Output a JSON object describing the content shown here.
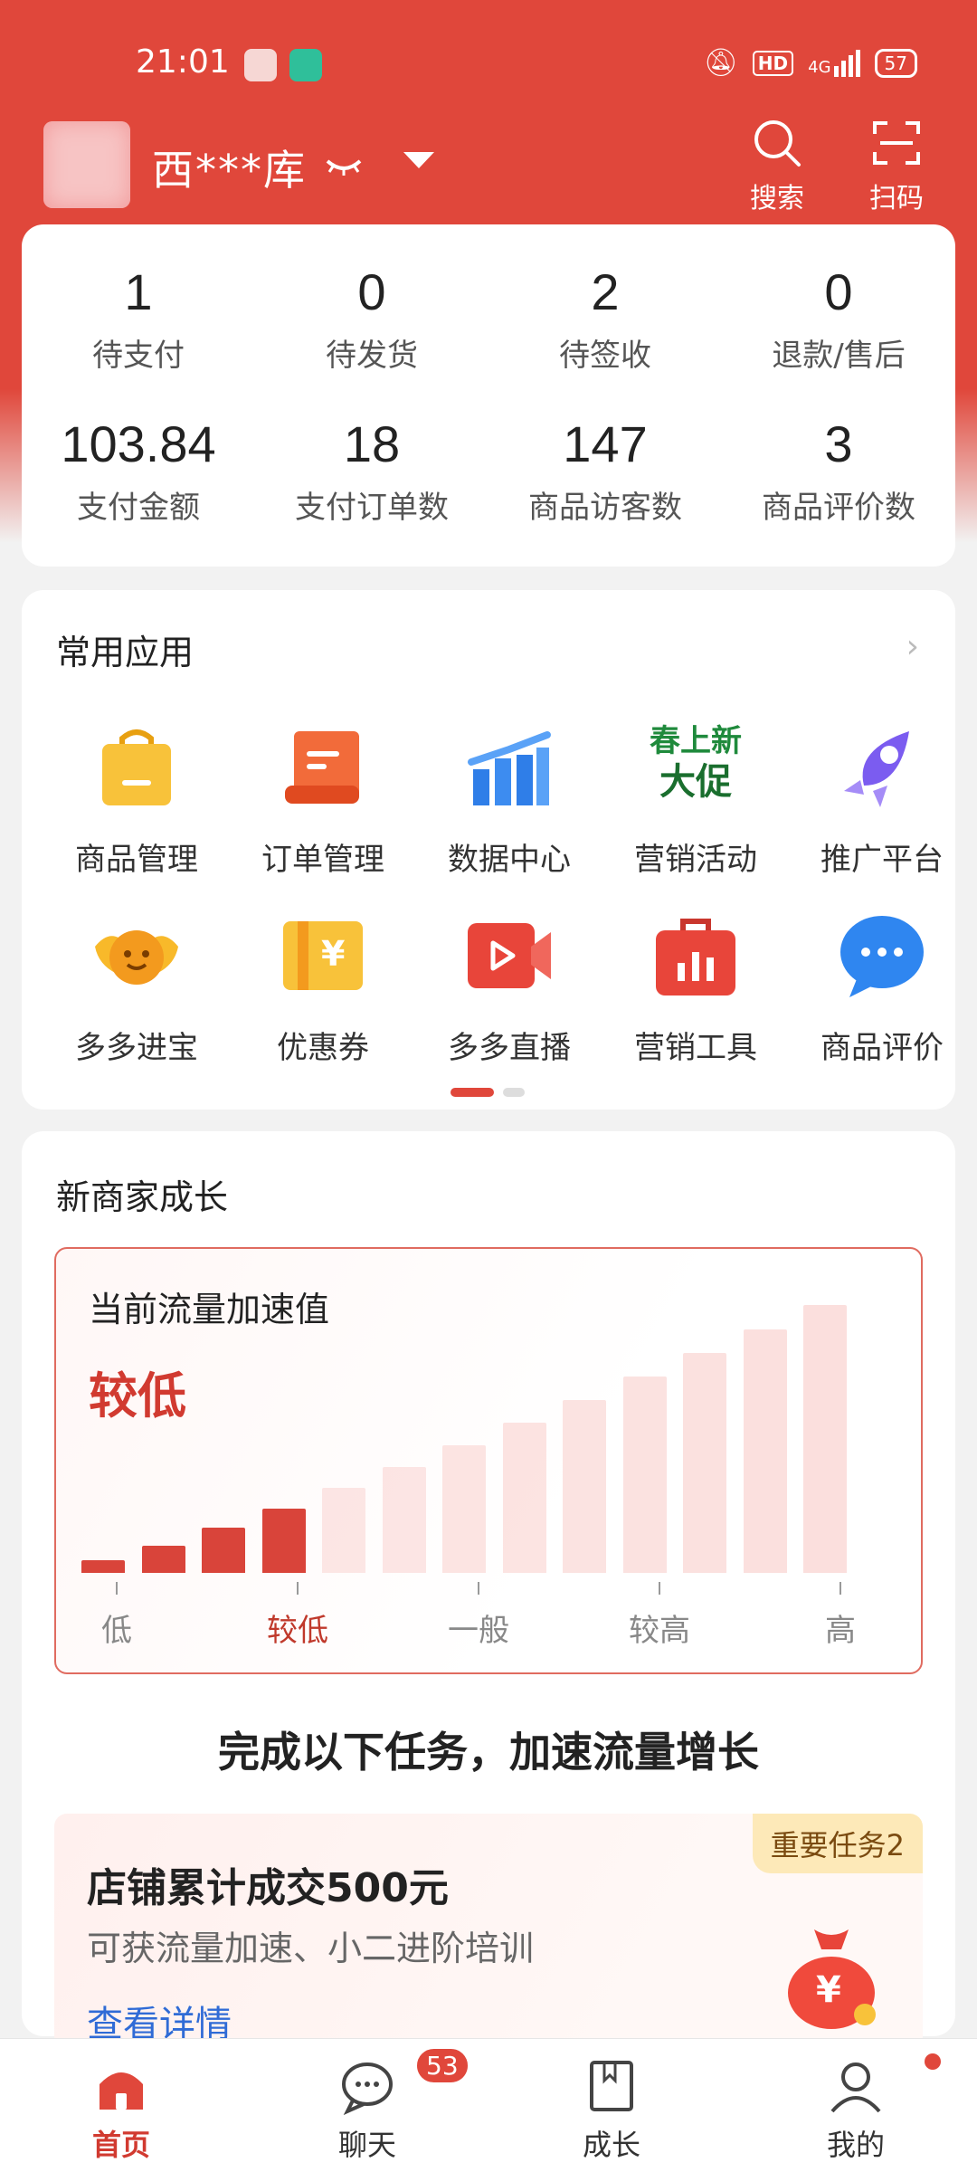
{
  "status_bar": {
    "time": "21:01",
    "signal": "4G",
    "hd": "HD",
    "battery": "57"
  },
  "header": {
    "shop_name": "西***库",
    "search_label": "搜索",
    "scan_label": "扫码"
  },
  "stats": [
    {
      "value": "1",
      "label": "待支付"
    },
    {
      "value": "0",
      "label": "待发货"
    },
    {
      "value": "2",
      "label": "待签收"
    },
    {
      "value": "0",
      "label": "退款/售后"
    },
    {
      "value": "103.84",
      "label": "支付金额"
    },
    {
      "value": "18",
      "label": "支付订单数"
    },
    {
      "value": "147",
      "label": "商品访客数"
    },
    {
      "value": "3",
      "label": "商品评价数"
    }
  ],
  "apps": {
    "title": "常用应用",
    "items": [
      {
        "label": "商品管理",
        "icon": "shopping-bag-icon"
      },
      {
        "label": "订单管理",
        "icon": "scroll-icon"
      },
      {
        "label": "数据中心",
        "icon": "bar-chart-icon"
      },
      {
        "label": "营销活动",
        "icon": "spring-promo-icon",
        "icon_text_1": "春上新",
        "icon_text_2": "大促"
      },
      {
        "label": "推广平台",
        "icon": "rocket-icon"
      },
      {
        "label": "多多进宝",
        "icon": "treasure-face-icon"
      },
      {
        "label": "优惠券",
        "icon": "coupon-icon",
        "icon_text": "¥"
      },
      {
        "label": "多多直播",
        "icon": "video-camera-icon"
      },
      {
        "label": "营销工具",
        "icon": "toolbox-icon"
      },
      {
        "label": "商品评价",
        "icon": "chat-bubble-icon"
      }
    ]
  },
  "growth": {
    "title": "新商家成长",
    "traffic_title": "当前流量加速值",
    "traffic_level": "较低",
    "level_index": 3,
    "bar_count": 13,
    "axis_labels": [
      "低",
      "较低",
      "一般",
      "较高",
      "高"
    ],
    "tasks_heading": "完成以下任务，加速流量增长",
    "task": {
      "badge": "重要任务2",
      "title": "店铺累计成交500元",
      "desc": "可获流量加速、小二进阶培训",
      "link": "查看详情",
      "bag_symbol": "¥"
    }
  },
  "nav": {
    "items": [
      {
        "label": "首页",
        "icon": "home-icon"
      },
      {
        "label": "聊天",
        "icon": "chat-icon",
        "badge": "53"
      },
      {
        "label": "成长",
        "icon": "book-icon"
      },
      {
        "label": "我的",
        "icon": "user-icon"
      }
    ]
  },
  "colors": {
    "brand_red": "#e0473b",
    "link_blue": "#2f6bd6"
  }
}
